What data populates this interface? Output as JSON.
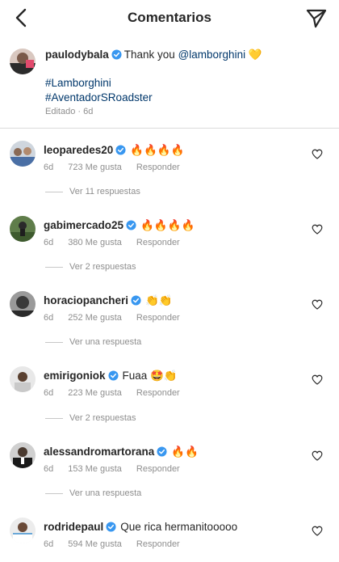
{
  "header": {
    "title": "Comentarios"
  },
  "caption": {
    "username": "paulodybala",
    "text_before": "Thank you",
    "mention": "@lamborghini",
    "emoji": "💛",
    "hashtags": [
      "#Lamborghini",
      "#AventadorSRoadster"
    ],
    "meta": "Editado · 6d"
  },
  "comments": [
    {
      "username": "leoparedes20",
      "text": "🔥🔥🔥🔥",
      "time": "6d",
      "likes": "723 Me gusta",
      "reply": "Responder",
      "view_replies": "Ver 11 respuestas"
    },
    {
      "username": "gabimercado25",
      "text": "🔥🔥🔥🔥",
      "time": "6d",
      "likes": "380 Me gusta",
      "reply": "Responder",
      "view_replies": "Ver 2 respuestas"
    },
    {
      "username": "horaciopancheri",
      "text": "👏👏",
      "time": "6d",
      "likes": "252 Me gusta",
      "reply": "Responder",
      "view_replies": "Ver una respuesta"
    },
    {
      "username": "emirigoniok",
      "text": "Fuaa 🤩👏",
      "time": "6d",
      "likes": "223 Me gusta",
      "reply": "Responder",
      "view_replies": "Ver 2 respuestas"
    },
    {
      "username": "alessandromartorana",
      "text": "🔥🔥",
      "time": "6d",
      "likes": "153 Me gusta",
      "reply": "Responder",
      "view_replies": "Ver una respuesta"
    },
    {
      "username": "rodridepaul",
      "text": "Que rica hermanitooooo",
      "time": "6d",
      "likes": "594 Me gusta",
      "reply": "Responder"
    }
  ],
  "colors": {
    "verified": "#3897f0",
    "link": "#00376b",
    "meta": "#8e8e8e"
  }
}
